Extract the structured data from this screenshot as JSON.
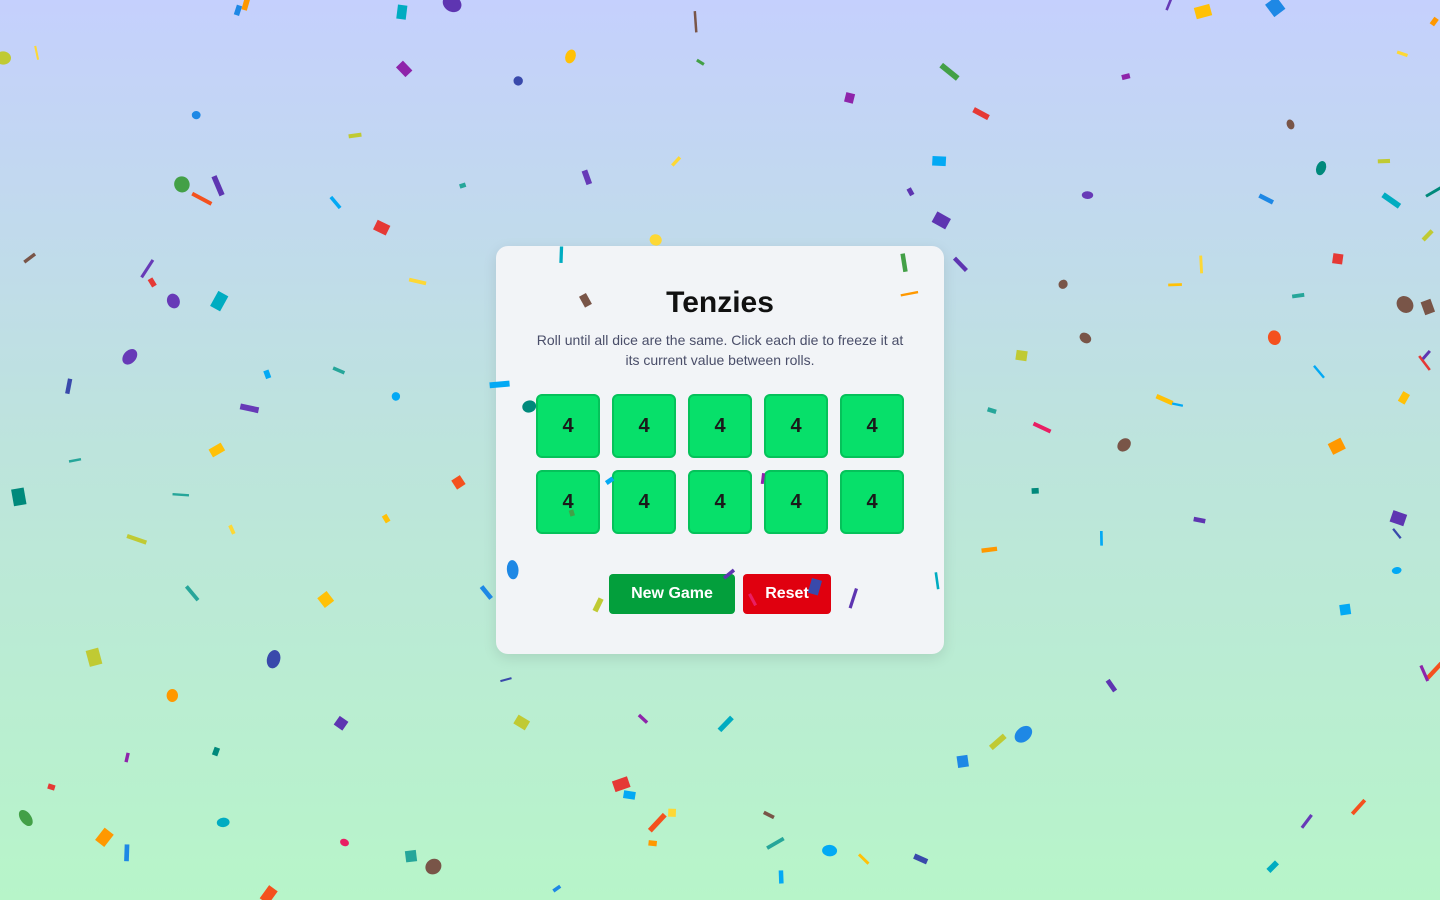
{
  "game": {
    "title": "Tenzies",
    "instructions": "Roll until all dice are the same. Click each die to freeze it at its current value between rolls.",
    "dice": [
      "4",
      "4",
      "4",
      "4",
      "4",
      "4",
      "4",
      "4",
      "4",
      "4"
    ],
    "new_game_label": "New Game",
    "reset_label": "Reset"
  },
  "colors": {
    "die_held": "#07e06a",
    "new_game_button": "#039f3c",
    "reset_button": "#e0000f",
    "card_background": "#f2f4f7"
  },
  "confetti_palette": [
    "#f4511e",
    "#fdd835",
    "#8e24aa",
    "#1e88e5",
    "#00acc1",
    "#43a047",
    "#e91e63",
    "#ff9800",
    "#3949ab",
    "#5e35b1",
    "#795548",
    "#c0ca33",
    "#00897b",
    "#03a9f4",
    "#ffc107",
    "#e53935",
    "#673ab7",
    "#26a69a"
  ]
}
